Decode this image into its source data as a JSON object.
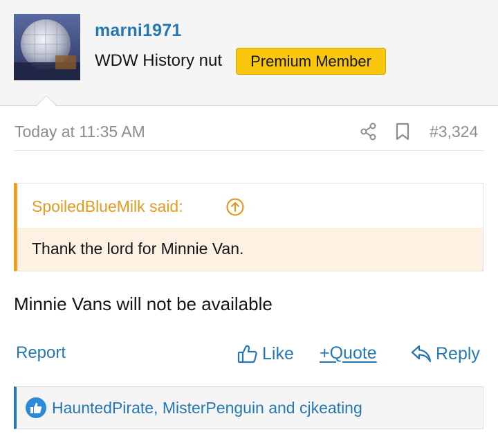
{
  "user": {
    "name": "marni1971",
    "title": "WDW History nut",
    "badge": "Premium Member"
  },
  "post": {
    "timestamp": "Today at 11:35 AM",
    "number": "#3,324",
    "quote": {
      "author_line": "SpoiledBlueMilk said:",
      "text": "Thank the lord for Minnie Van."
    },
    "body": "Minnie Vans will not be available"
  },
  "actions": {
    "report": "Report",
    "like": "Like",
    "quote": "+Quote",
    "reply": "Reply"
  },
  "reactions": {
    "text": "HauntedPirate, MisterPenguin and cjkeating"
  },
  "icons": {
    "share": "share-icon",
    "bookmark": "bookmark-icon",
    "quote_arrow": "arrow-up-circle-icon",
    "like": "thumbs-up-icon",
    "reply": "reply-arrow-icon",
    "reaction": "like-reaction-icon"
  },
  "colors": {
    "link": "#2577b1",
    "quote_accent": "#f0a020",
    "badge": "#f9c80e",
    "muted": "#8c8c8c"
  }
}
